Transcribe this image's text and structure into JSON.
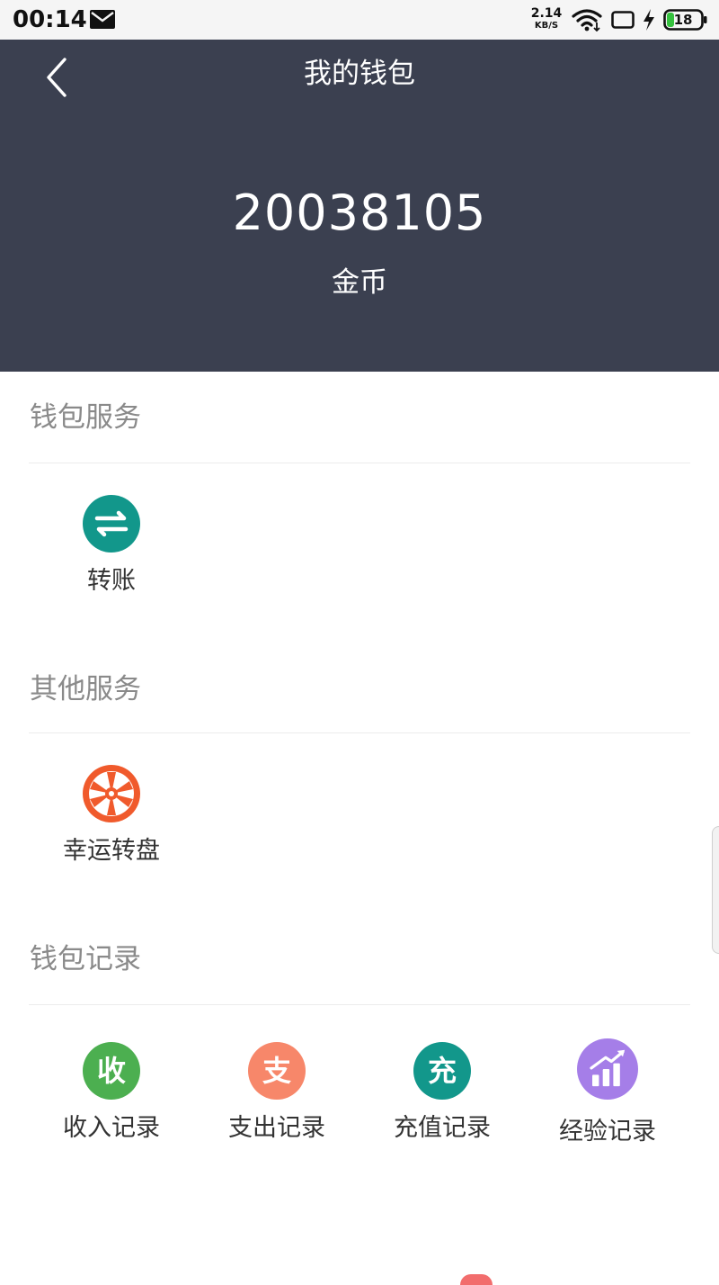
{
  "status_bar": {
    "time": "00:14",
    "net_speed_value": "2.14",
    "net_speed_unit": "KB/S",
    "battery_level": "18"
  },
  "header": {
    "title": "我的钱包",
    "balance": "20038105",
    "balance_unit": "金币"
  },
  "sections": {
    "wallet_services": {
      "title": "钱包服务",
      "items": [
        {
          "label": "转账",
          "icon": "transfer-arrows-icon",
          "color": "#12978b"
        }
      ]
    },
    "other_services": {
      "title": "其他服务",
      "items": [
        {
          "label": "幸运转盘",
          "icon": "lucky-wheel-icon",
          "color": "#f05a2c"
        }
      ]
    },
    "wallet_records": {
      "title": "钱包记录",
      "items": [
        {
          "label": "收入记录",
          "glyph": "收",
          "icon": "income-icon",
          "color": "#4caf50"
        },
        {
          "label": "支出记录",
          "glyph": "支",
          "icon": "expense-icon",
          "color": "#f7876a"
        },
        {
          "label": "充值记录",
          "glyph": "充",
          "icon": "recharge-icon",
          "color": "#12978b"
        },
        {
          "label": "经验记录",
          "icon": "experience-chart-icon",
          "color": "#a57ee8"
        }
      ]
    }
  },
  "colors": {
    "header_bg": "#3b4050",
    "status_bg": "#f5f5f5",
    "section_title": "#8a8a8a",
    "divider": "#ececec"
  }
}
